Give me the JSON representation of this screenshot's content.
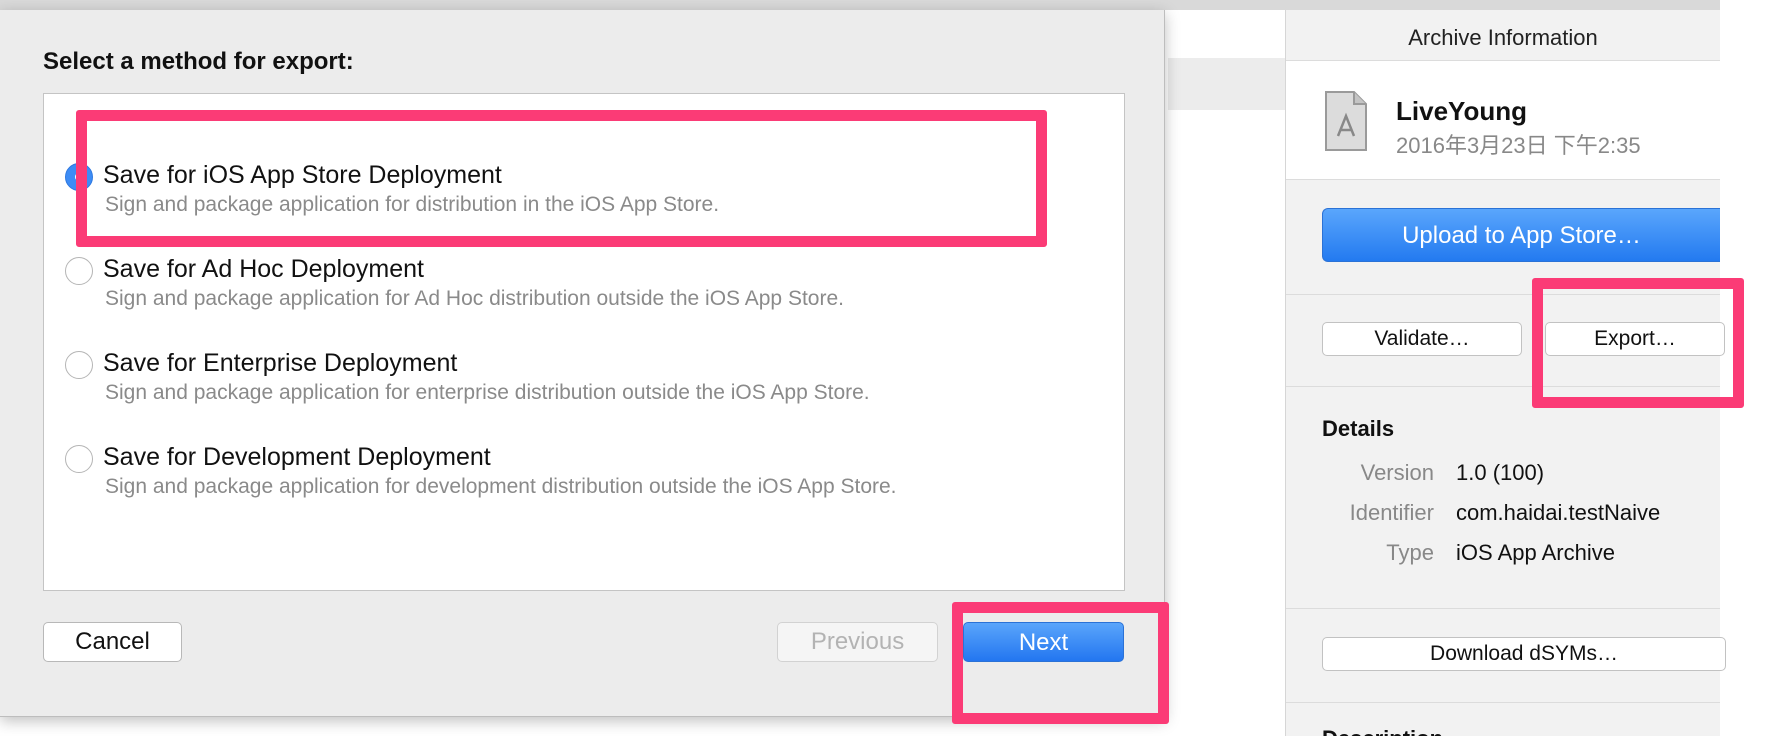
{
  "dialog": {
    "title": "Select a method for export:",
    "options": [
      {
        "title": "Save for iOS App Store Deployment",
        "description": "Sign and package application for distribution in the iOS App Store.",
        "selected": true
      },
      {
        "title": "Save for Ad Hoc Deployment",
        "description": "Sign and package application for Ad Hoc distribution outside the iOS App Store.",
        "selected": false
      },
      {
        "title": "Save for Enterprise Deployment",
        "description": "Sign and package application for enterprise distribution outside the iOS App Store.",
        "selected": false
      },
      {
        "title": "Save for Development Deployment",
        "description": "Sign and package application for development distribution outside the iOS App Store.",
        "selected": false
      }
    ],
    "cancel_label": "Cancel",
    "previous_label": "Previous",
    "next_label": "Next"
  },
  "panel": {
    "header": "Archive Information",
    "archive_name": "LiveYoung",
    "archive_date": "2016年3月23日 下午2:35",
    "upload_label": "Upload to App Store…",
    "validate_label": "Validate…",
    "export_label": "Export…",
    "details_title": "Details",
    "details": [
      {
        "label": "Version",
        "value": "1.0 (100)"
      },
      {
        "label": "Identifier",
        "value": "com.haidai.testNaive"
      },
      {
        "label": "Type",
        "value": "iOS App Archive"
      }
    ],
    "dsym_label": "Download dSYMs…",
    "description_title": "Description"
  },
  "colors": {
    "accent_blue": "#2f7ff2",
    "highlight": "#fb3b76"
  },
  "icons": {
    "archive_file": "app-archive-file-icon"
  }
}
